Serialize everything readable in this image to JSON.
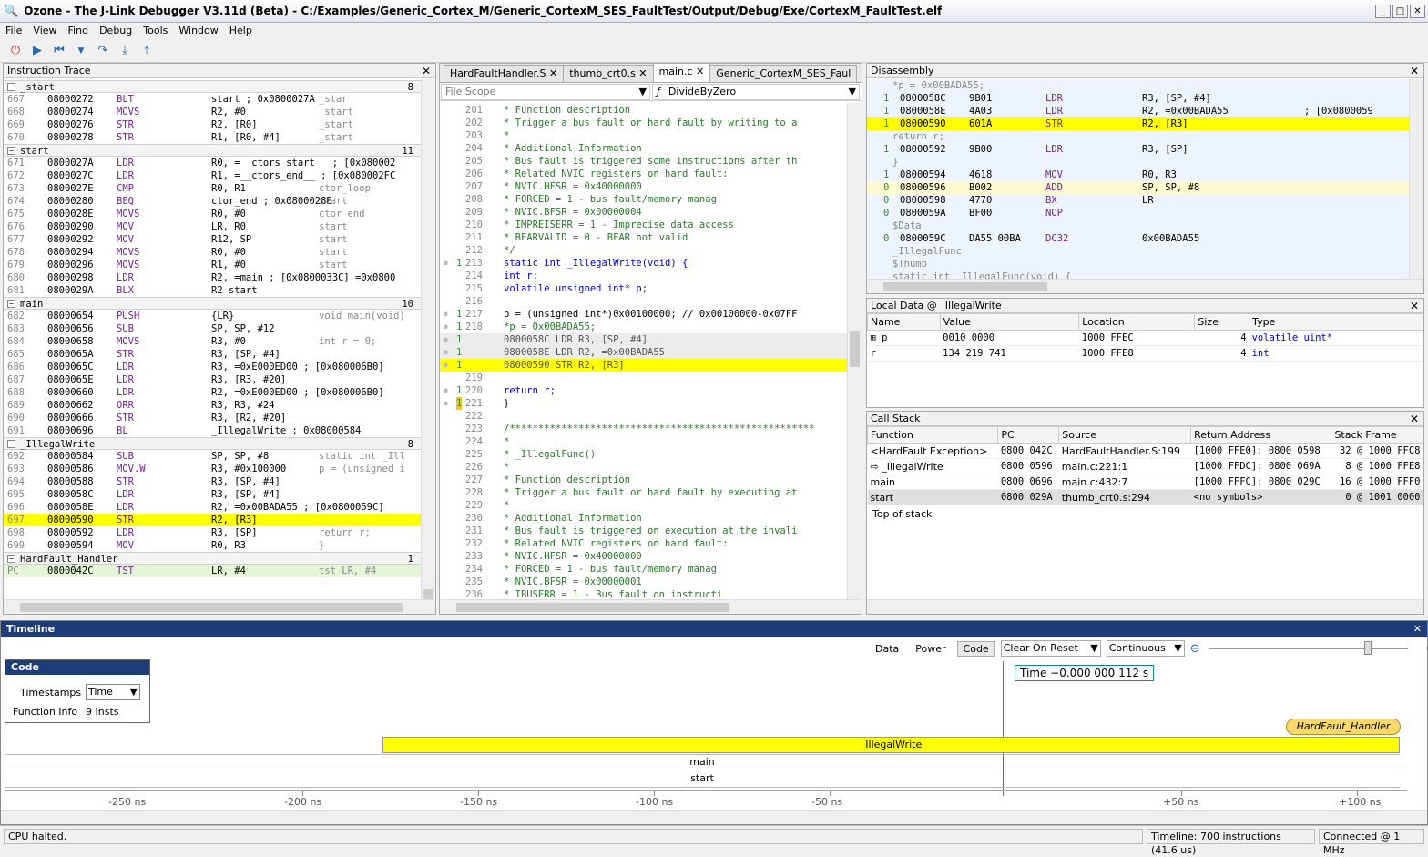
{
  "window": {
    "title": "Ozone - The J-Link Debugger V3.11d (Beta) - C:/Examples/Generic_Cortex_M/Generic_CortexM_SES_FaultTest/Output/Debug/Exe/CortexM_FaultTest.elf"
  },
  "menu": [
    "File",
    "View",
    "Find",
    "Debug",
    "Tools",
    "Window",
    "Help"
  ],
  "trace": {
    "title": "Instruction Trace",
    "groups": [
      {
        "name": "_start",
        "count": "8",
        "rows": [
          [
            "667",
            "08000272",
            "BLT",
            "start ; 0x0800027A",
            "_star"
          ],
          [
            "668",
            "08000274",
            "MOVS",
            "R2, #0",
            "_start"
          ],
          [
            "669",
            "08000276",
            "STR",
            "R2, [R0]",
            "_start"
          ],
          [
            "670",
            "08000278",
            "STR",
            "R1, [R0, #4]",
            "_start"
          ]
        ]
      },
      {
        "name": "start",
        "count": "11",
        "rows": [
          [
            "671",
            "0800027A",
            "LDR",
            "R0, =__ctors_start__ ; [0x080002",
            "",
            ""
          ],
          [
            "672",
            "0800027C",
            "LDR",
            "R1, =__ctors_end__ ; [0x080002FC",
            ""
          ],
          [
            "673",
            "0800027E",
            "CMP",
            "R0, R1",
            "ctor_loop"
          ],
          [
            "674",
            "08000280",
            "BEQ",
            "ctor_end ; 0x0800028E",
            "start"
          ],
          [
            "675",
            "0800028E",
            "MOVS",
            "R0, #0",
            "ctor_end"
          ],
          [
            "676",
            "08000290",
            "MOV",
            "LR, R0",
            "start"
          ],
          [
            "677",
            "08000292",
            "MOV",
            "R12, SP",
            "start"
          ],
          [
            "678",
            "08000294",
            "MOVS",
            "R0, #0",
            "start"
          ],
          [
            "679",
            "08000296",
            "MOVS",
            "R1, #0",
            "start"
          ],
          [
            "680",
            "08000298",
            "LDR",
            "R2, =main ; [0x0800033C] =0x0800",
            ""
          ],
          [
            "681",
            "0800029A",
            "BLX",
            "R2       start",
            ""
          ]
        ]
      },
      {
        "name": "main",
        "count": "10",
        "rows": [
          [
            "682",
            "08000654",
            "PUSH",
            "{LR}",
            "void main(void)"
          ],
          [
            "683",
            "08000656",
            "SUB",
            "SP, SP, #12",
            ""
          ],
          [
            "684",
            "08000658",
            "MOVS",
            "R3, #0",
            "int r = 0;"
          ],
          [
            "685",
            "0800065A",
            "STR",
            "R3, [SP, #4]",
            ""
          ],
          [
            "686",
            "0800065C",
            "LDR",
            "R3, =0xE000ED00 ; [0x080006B0]",
            ""
          ],
          [
            "687",
            "0800065E",
            "LDR",
            "R3, [R3, #20]",
            ""
          ],
          [
            "688",
            "08000660",
            "LDR",
            "R2, =0xE000ED00 ; [0x080006B0]",
            ""
          ],
          [
            "689",
            "08000662",
            "ORR",
            "R3, R3, #24",
            ""
          ],
          [
            "690",
            "08000666",
            "STR",
            "R3, [R2, #20]",
            ""
          ],
          [
            "691",
            "08000696",
            "BL",
            "_IllegalWrite ; 0x08000584",
            ""
          ]
        ]
      },
      {
        "name": "_IllegalWrite",
        "count": "8",
        "rows": [
          [
            "692",
            "08000584",
            "SUB",
            "SP, SP, #8",
            "static int _Ill"
          ],
          [
            "693",
            "08000586",
            "MOV.W",
            "R3, #0x100000",
            "p = (unsigned i"
          ],
          [
            "694",
            "08000588",
            "STR",
            "R3, [SP, #4]",
            ""
          ],
          [
            "695",
            "0800058C",
            "LDR",
            "R3, [SP, #4]",
            ""
          ],
          [
            "696",
            "0800058E",
            "LDR",
            "R2, =0x00BADA55 ; [0x0800059C]",
            ""
          ],
          [
            "697",
            "08000590",
            "STR",
            "R2, [R3]",
            ""
          ],
          [
            "698",
            "08000592",
            "LDR",
            "R3, [SP]",
            "return r;"
          ],
          [
            "699",
            "08000594",
            "MOV",
            "R0, R3",
            "}"
          ]
        ]
      },
      {
        "name": "HardFault_Handler",
        "count": "1",
        "rows": [
          [
            "PC",
            "0800042C",
            "TST",
            "LR, #4",
            "tst     LR, #4"
          ]
        ]
      }
    ]
  },
  "editor": {
    "tabs": [
      "HardFaultHandler.S",
      "thumb_crt0.s",
      "main.c",
      "Generic_CortexM_SES_Faul"
    ],
    "scope": "File Scope",
    "func": "_DivideByZero",
    "lines": [
      [
        "201",
        "",
        "  *  Function description"
      ],
      [
        "202",
        "",
        "  *   Trigger a bus fault or hard fault by writing to a"
      ],
      [
        "203",
        "",
        "  *"
      ],
      [
        "204",
        "",
        "  *  Additional Information"
      ],
      [
        "205",
        "",
        "  *    Bus fault is triggered some instructions after th"
      ],
      [
        "206",
        "",
        "  *    Related NVIC registers on hard fault:"
      ],
      [
        "207",
        "",
        "  *      NVIC.HFSR = 0x40000000"
      ],
      [
        "208",
        "",
        "  *        FORCED = 1          - bus fault/memory manag"
      ],
      [
        "209",
        "",
        "  *      NVIC.BFSR = 0x00000004"
      ],
      [
        "210",
        "",
        "  *        IMPREISERR = 1      - Imprecise data access"
      ],
      [
        "211",
        "",
        "  *        BFARVALID = 0       - BFAR not valid"
      ],
      [
        "212",
        "",
        "  */"
      ],
      [
        "213",
        "1",
        "static int _IllegalWrite(void) {"
      ],
      [
        "214",
        "",
        "  int r;"
      ],
      [
        "215",
        "",
        "  volatile unsigned int* p;"
      ],
      [
        "216",
        "",
        ""
      ],
      [
        "217",
        "1",
        "  p = (unsigned int*)0x00100000;  // 0x00100000-0x07FF"
      ],
      [
        "218",
        "1",
        "  *p = 0x00BADA55;"
      ],
      [
        "",
        "1",
        "    0800058C  LDR         R3, [SP, #4]"
      ],
      [
        "",
        "1",
        "    0800058E  LDR         R2, =0x00BADA55"
      ],
      [
        "",
        "1",
        "    08000590  STR         R2, [R3]"
      ],
      [
        "219",
        "",
        ""
      ],
      [
        "220",
        "1",
        "  return r;"
      ],
      [
        "221",
        "1",
        "}"
      ],
      [
        "222",
        "",
        ""
      ],
      [
        "223",
        "",
        "/*****************************************************"
      ],
      [
        "224",
        "",
        "  *"
      ],
      [
        "225",
        "",
        "  *       _IllegalFunc()"
      ],
      [
        "226",
        "",
        "  *"
      ],
      [
        "227",
        "",
        "  *  Function description"
      ],
      [
        "228",
        "",
        "  *   Trigger a bus fault or hard fault by executing at"
      ],
      [
        "229",
        "",
        "  *"
      ],
      [
        "230",
        "",
        "  *  Additional Information"
      ],
      [
        "231",
        "",
        "  *    Bus fault is triggered on execution at the invali"
      ],
      [
        "232",
        "",
        "  *    Related NVIC registers on hard fault:"
      ],
      [
        "233",
        "",
        "  *      NVIC.HFSR = 0x40000000"
      ],
      [
        "234",
        "",
        "  *        FORCED = 1          - bus fault/memory manag"
      ],
      [
        "235",
        "",
        "  *      NVIC.BFSR = 0x00000001"
      ],
      [
        "236",
        "",
        "  *        IBUSERR = 1         - Bus fault on instructi"
      ]
    ]
  },
  "disasm": {
    "title": "Disassembly",
    "lines": [
      [
        "",
        "",
        "",
        "*p = 0x00BADA55;",
        "",
        ""
      ],
      [
        "1",
        "0800058C",
        "9B01",
        "LDR",
        "R3, [SP, #4]",
        ""
      ],
      [
        "1",
        "0800058E",
        "4A03",
        "LDR",
        "R2, =0x00BADA55",
        "; [0x0800059"
      ],
      [
        "1",
        "08000590",
        "601A",
        "STR",
        "R2, [R3]",
        ""
      ],
      [
        "",
        "",
        "",
        "return r;",
        "",
        ""
      ],
      [
        "1",
        "08000592",
        "9B00",
        "LDR",
        "R3, [SP]",
        ""
      ],
      [
        "",
        "",
        "",
        "}",
        "",
        ""
      ],
      [
        "1",
        "08000594",
        "4618",
        "MOV",
        "R0, R3",
        ""
      ],
      [
        "0",
        "08000596",
        "B002",
        "ADD",
        "SP, SP, #8",
        ""
      ],
      [
        "0",
        "08000598",
        "4770",
        "BX",
        "LR",
        ""
      ],
      [
        "0",
        "0800059A",
        "BF00",
        "NOP",
        "",
        ""
      ],
      [
        "",
        "",
        "",
        "$Data",
        "",
        ""
      ],
      [
        "0",
        "0800059C",
        "DA55 00BA",
        "DC32",
        "0x00BADA55",
        ""
      ],
      [
        "",
        "",
        "",
        "_IllegalFunc",
        "",
        ""
      ],
      [
        "",
        "",
        "",
        "$Thumb",
        "",
        ""
      ],
      [
        "",
        "",
        "",
        "static int _IllegalFunc(void) {",
        "",
        ""
      ]
    ]
  },
  "locals": {
    "title": "Local Data @ _IllegalWrite",
    "headers": [
      "Name",
      "Value",
      "Location",
      "Size",
      "Type"
    ],
    "rows": [
      [
        "p",
        "0010 0000",
        "1000 FFEC",
        "4",
        "volatile uint*"
      ],
      [
        "r",
        "134 219 741",
        "1000 FFE8",
        "4",
        "int"
      ]
    ]
  },
  "callstack": {
    "title": "Call Stack",
    "headers": [
      "Function",
      "PC",
      "Source",
      "Return Address",
      "Stack Frame"
    ],
    "rows": [
      [
        "<HardFault Exception>",
        "0800 042C",
        "HardFaultHandler.S:199",
        "[1000 FFE0]: 0800 0598",
        "32 @ 1000 FFC8"
      ],
      [
        "_IllegalWrite",
        "0800 0596",
        "main.c:221:1",
        "[1000 FFDC]: 0800 069A",
        "8 @ 1000 FFE8"
      ],
      [
        "main",
        "0800 0696",
        "main.c:432:7",
        "[1000 FFFC]: 0800 029C",
        "16 @ 1000 FFF0"
      ],
      [
        "start",
        "0800 029A",
        "thumb_crt0.s:294",
        "<no symbols>",
        "0 @ 1001 0000"
      ]
    ],
    "footer": "Top of stack"
  },
  "timeline": {
    "title": "Timeline",
    "tabs": [
      "Data",
      "Power",
      "Code"
    ],
    "reset": "Clear On Reset",
    "mode": "Continuous",
    "code_box": {
      "title": "Code",
      "ts_label": "Timestamps",
      "ts_value": "Time",
      "fi_label": "Function Info",
      "fi_value": "9 Insts"
    },
    "cursor": "Time   −0.000 000 112 s",
    "bars": [
      "HardFault_Handler",
      "_IllegalWrite",
      "main",
      "start"
    ],
    "ticks": [
      "-250 ns",
      "-200 ns",
      "-150 ns",
      "-100 ns",
      "-50 ns",
      "+50 ns",
      "+100 ns"
    ]
  },
  "status": {
    "left": "CPU halted.",
    "mid": "Timeline: 700 instructions (41.6 us)",
    "right": "Connected @ 1 MHz"
  }
}
